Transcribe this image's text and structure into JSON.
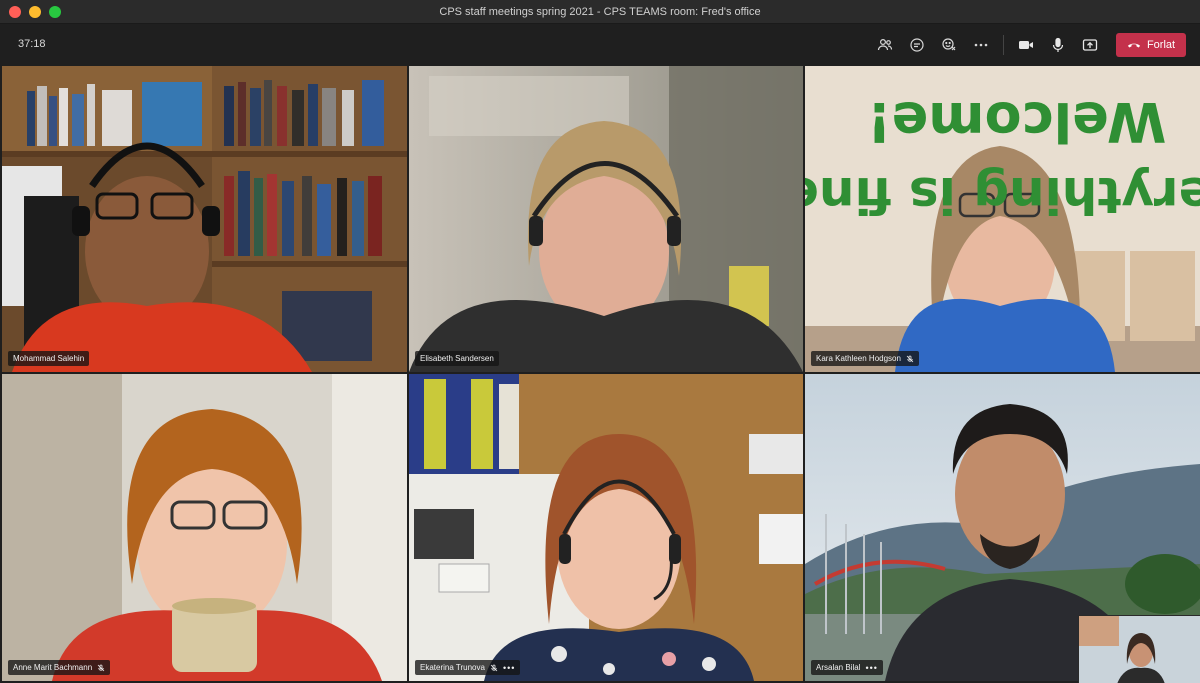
{
  "window": {
    "title": "CPS staff meetings spring 2021 - CPS TEAMS room: Fred's office"
  },
  "toolbar": {
    "timer": "37:18",
    "leave_label": "Forlat",
    "icons": [
      "people-icon",
      "chat-icon",
      "reactions-icon",
      "more-icon",
      "camera-icon",
      "mic-icon",
      "share-icon",
      "phone-hangup-icon"
    ]
  },
  "participants": [
    {
      "name": "Mohammad Salehin",
      "muted": false
    },
    {
      "name": "Elisabeth Sandersen",
      "muted": false
    },
    {
      "name": "Kara Kathleen Hodgson",
      "muted": true
    },
    {
      "name": "Anne Marit Bachmann",
      "muted": true
    },
    {
      "name": "Ekaterina Trunova",
      "muted": true
    },
    {
      "name": "Arsalan Bilal",
      "muted": false
    }
  ],
  "background_text": {
    "line1": "Welcome!",
    "line2": "Everything is fine"
  },
  "colors": {
    "leave_button": "#c4314b",
    "background": "#1f1f1f"
  }
}
